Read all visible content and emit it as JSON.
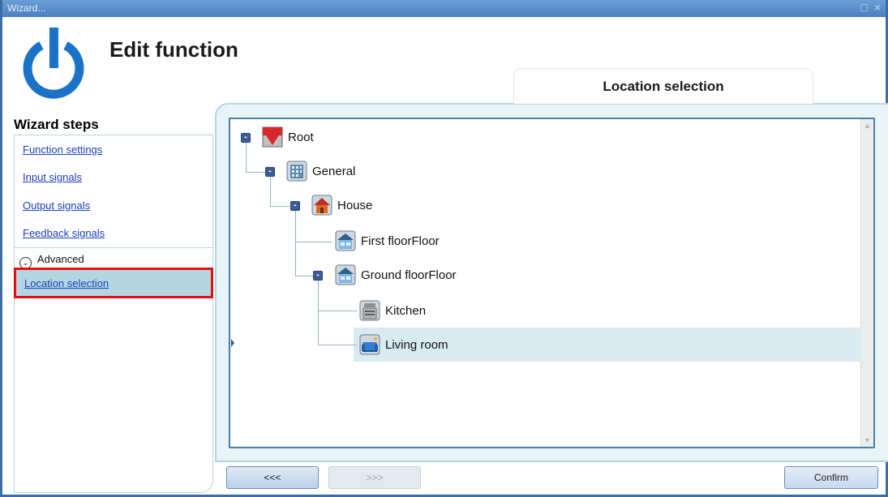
{
  "window": {
    "title": "Wizard...",
    "controls": [
      "□",
      "×"
    ]
  },
  "header": {
    "title": "Edit function"
  },
  "section": {
    "title": "Location selection"
  },
  "wizard_steps": {
    "title": "Wizard steps",
    "items": [
      {
        "label": "Function settings"
      },
      {
        "label": "Input signals"
      },
      {
        "label": "Output signals"
      },
      {
        "label": "Feedback signals"
      }
    ],
    "advanced": {
      "label": "Advanced",
      "icon": "chevron-down-icon"
    },
    "advanced_items": [
      {
        "label": "Location selection",
        "selected": true
      }
    ]
  },
  "tree": {
    "nodes": [
      {
        "label": "Root",
        "icon": "root-logo-icon",
        "expanded": true
      },
      {
        "label": "General",
        "icon": "building-icon",
        "expanded": true
      },
      {
        "label": "House",
        "icon": "house-icon",
        "expanded": true
      },
      {
        "label": "First floorFloor",
        "icon": "floor-icon"
      },
      {
        "label": "Ground floorFloor",
        "icon": "floor-icon",
        "expanded": true
      },
      {
        "label": "Kitchen",
        "icon": "kitchen-icon"
      },
      {
        "label": "Living room",
        "icon": "living-room-icon",
        "selected": true
      }
    ]
  },
  "buttons": {
    "back": "<<<",
    "next": ">>>",
    "confirm": "Confirm"
  },
  "colors": {
    "accent": "#3a6ea5",
    "selection": "#b5d5e1",
    "highlight_border": "#e01010",
    "link": "#1a3fb8"
  }
}
